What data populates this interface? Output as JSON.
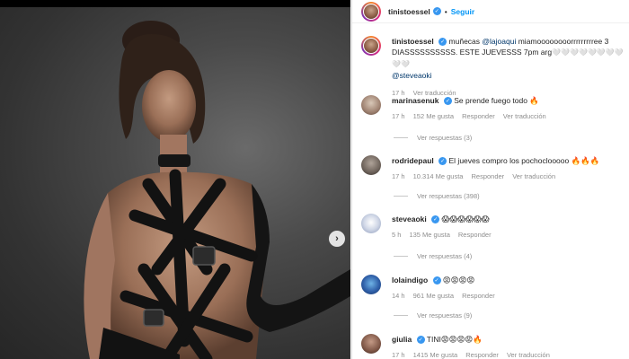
{
  "post": {
    "author": "tinistoessel",
    "follow_label": "Seguir",
    "dot": "•"
  },
  "caption": {
    "user": "tinistoessel",
    "text_1": "muñecas",
    "mention_1": "@lajoaqui",
    "text_2": "miamoooooooorrrrrrrrree 3 DIASSSSSSSSSS. ESTE JUEVESSS 7pm arg",
    "text_3": "🤍🤍🤍🤍🤍🤍🤍🤍🤍🤍",
    "mention_2": "@steveaoki",
    "time": "17 h",
    "translate": "Ver traducción"
  },
  "comments": [
    {
      "user": "marinasenuk",
      "verified": true,
      "text": "Se prende fuego todo 🔥",
      "time": "17 h",
      "likes": "152 Me gusta",
      "reply": "Responder",
      "translate": "Ver traducción",
      "replies": "Ver respuestas (3)"
    },
    {
      "user": "rodridepaul",
      "verified": true,
      "text": "El jueves compro los pochoclooooo 🔥🔥🔥",
      "time": "17 h",
      "likes": "10.314 Me gusta",
      "reply": "Responder",
      "translate": "Ver traducción",
      "replies": "Ver respuestas (398)"
    },
    {
      "user": "steveaoki",
      "verified": true,
      "text": "😱😱😱😱😱😱",
      "time": "5 h",
      "likes": "135 Me gusta",
      "reply": "Responder",
      "translate": "",
      "replies": "Ver respuestas (4)"
    },
    {
      "user": "lolaindigo",
      "verified": true,
      "text": "😡😡😡😡",
      "time": "14 h",
      "likes": "961 Me gusta",
      "reply": "Responder",
      "translate": "",
      "replies": "Ver respuestas (9)"
    },
    {
      "user": "giulia",
      "verified": true,
      "text": "TINI😡😡😡😡🔥",
      "time": "17 h",
      "likes": "1415 Me gusta",
      "reply": "Responder",
      "translate": "Ver traducción",
      "replies": ""
    }
  ],
  "icons": {
    "next": "chevron-right-icon",
    "verified": "verified-badge-icon"
  },
  "colors": {
    "link": "#0095f6",
    "verified": "#3897f0",
    "mention": "#00376b",
    "meta": "#8e8e8e"
  }
}
